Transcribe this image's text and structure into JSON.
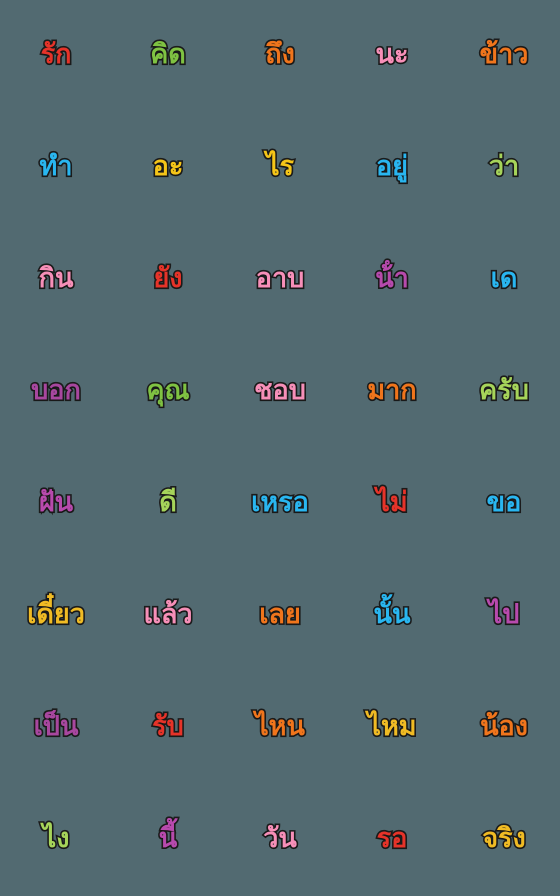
{
  "page": {
    "background_color": "#526a71",
    "outline_color": "#1b1b1b",
    "grid": {
      "columns": 5,
      "rows": 8,
      "total_items": 40
    }
  },
  "palette": {
    "red": "#e63329",
    "green": "#7fc242",
    "orange": "#f0751c",
    "pink": "#f78fb8",
    "cyan": "#29b6f0",
    "yellow": "#f5c518",
    "light_green": "#a6d45a",
    "purple": "#a8479f",
    "magenta": "#b74aad",
    "gold": "#f0bb24"
  },
  "stickers": [
    {
      "text": "รัก",
      "color": "#e63329",
      "row": 1,
      "col": 1
    },
    {
      "text": "คิด",
      "color": "#7fc242",
      "row": 1,
      "col": 2
    },
    {
      "text": "ถึง",
      "color": "#f0751c",
      "row": 1,
      "col": 3
    },
    {
      "text": "นะ",
      "color": "#f78fb8",
      "row": 1,
      "col": 4
    },
    {
      "text": "ข้าว",
      "color": "#f0751c",
      "row": 1,
      "col": 5
    },
    {
      "text": "ทํา",
      "color": "#29b6f0",
      "row": 2,
      "col": 1
    },
    {
      "text": "อะ",
      "color": "#f5c518",
      "row": 2,
      "col": 2
    },
    {
      "text": "ไร",
      "color": "#f5c518",
      "row": 2,
      "col": 3
    },
    {
      "text": "อยู่",
      "color": "#29b6f0",
      "row": 2,
      "col": 4
    },
    {
      "text": "ว่า",
      "color": "#a6d45a",
      "row": 2,
      "col": 5
    },
    {
      "text": "กิน",
      "color": "#f78fb8",
      "row": 3,
      "col": 1
    },
    {
      "text": "ยัง",
      "color": "#e63329",
      "row": 3,
      "col": 2
    },
    {
      "text": "อาบ",
      "color": "#f78fb8",
      "row": 3,
      "col": 3
    },
    {
      "text": "น้ํา",
      "color": "#b74aad",
      "row": 3,
      "col": 4
    },
    {
      "text": "เด",
      "color": "#29b6f0",
      "row": 3,
      "col": 5
    },
    {
      "text": "บอก",
      "color": "#a8479f",
      "row": 4,
      "col": 1
    },
    {
      "text": "คุณ",
      "color": "#7fc242",
      "row": 4,
      "col": 2
    },
    {
      "text": "ชอบ",
      "color": "#f78fb8",
      "row": 4,
      "col": 3
    },
    {
      "text": "มาก",
      "color": "#f0751c",
      "row": 4,
      "col": 4
    },
    {
      "text": "ครับ",
      "color": "#a6d45a",
      "row": 4,
      "col": 5
    },
    {
      "text": "ฝัน",
      "color": "#b74aad",
      "row": 5,
      "col": 1
    },
    {
      "text": "ดี",
      "color": "#a6d45a",
      "row": 5,
      "col": 2
    },
    {
      "text": "เหรอ",
      "color": "#29b6f0",
      "row": 5,
      "col": 3
    },
    {
      "text": "ไม่",
      "color": "#e63329",
      "row": 5,
      "col": 4
    },
    {
      "text": "ขอ",
      "color": "#29b6f0",
      "row": 5,
      "col": 5
    },
    {
      "text": "เดี๋ยว",
      "color": "#f0bb24",
      "row": 6,
      "col": 1
    },
    {
      "text": "แล้ว",
      "color": "#f78fb8",
      "row": 6,
      "col": 2
    },
    {
      "text": "เลย",
      "color": "#f0751c",
      "row": 6,
      "col": 3
    },
    {
      "text": "นั้น",
      "color": "#29b6f0",
      "row": 6,
      "col": 4
    },
    {
      "text": "ไป",
      "color": "#b74aad",
      "row": 6,
      "col": 5
    },
    {
      "text": "เป็น",
      "color": "#a8479f",
      "row": 7,
      "col": 1
    },
    {
      "text": "รับ",
      "color": "#e63329",
      "row": 7,
      "col": 2
    },
    {
      "text": "ไหน",
      "color": "#f0751c",
      "row": 7,
      "col": 3
    },
    {
      "text": "ไหม",
      "color": "#f0bb24",
      "row": 7,
      "col": 4
    },
    {
      "text": "น้อง",
      "color": "#f0751c",
      "row": 7,
      "col": 5
    },
    {
      "text": "ไง",
      "color": "#a6d45a",
      "row": 8,
      "col": 1
    },
    {
      "text": "นี้",
      "color": "#b74aad",
      "row": 8,
      "col": 2
    },
    {
      "text": "วัน",
      "color": "#f78fb8",
      "row": 8,
      "col": 3
    },
    {
      "text": "รอ",
      "color": "#e63329",
      "row": 8,
      "col": 4
    },
    {
      "text": "จริง",
      "color": "#f0bb24",
      "row": 8,
      "col": 5
    }
  ]
}
